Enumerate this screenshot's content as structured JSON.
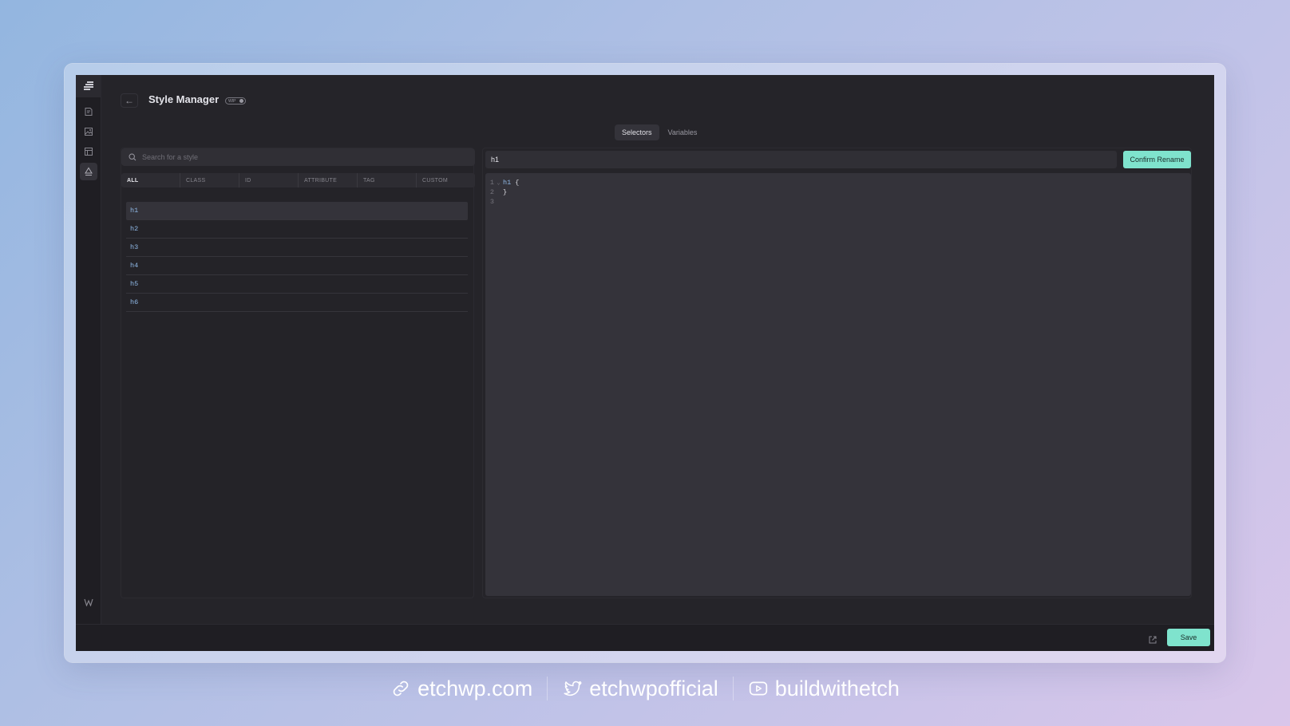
{
  "page": {
    "title": "Style Manager",
    "badge": "WIP",
    "back_label": "←"
  },
  "tabs": [
    {
      "label": "Selectors",
      "active": true
    },
    {
      "label": "Variables",
      "active": false
    }
  ],
  "search": {
    "placeholder": "Search for a style"
  },
  "filters": [
    "ALL",
    "CLASS",
    "ID",
    "ATTRIBUTE",
    "TAG",
    "CUSTOM"
  ],
  "styles": [
    "h1",
    "h2",
    "h3",
    "h4",
    "h5",
    "h6"
  ],
  "editor": {
    "selector_value": "h1",
    "confirm_label": "Confirm Rename",
    "code": {
      "line1_num": "1",
      "line1_fold": "⌄",
      "line1_selector": "h1",
      "line1_brace": "{",
      "line2_num": "2",
      "line2_brace": "}",
      "line3_num": "3"
    }
  },
  "bottom": {
    "save_label": "Save"
  },
  "footer": {
    "website": "etchwp.com",
    "twitter": "etchwpofficial",
    "youtube": "buildwithetch"
  },
  "colors": {
    "accent": "#7fe3cd",
    "selector_blue": "#8fb8e6",
    "app_bg": "#252429"
  }
}
